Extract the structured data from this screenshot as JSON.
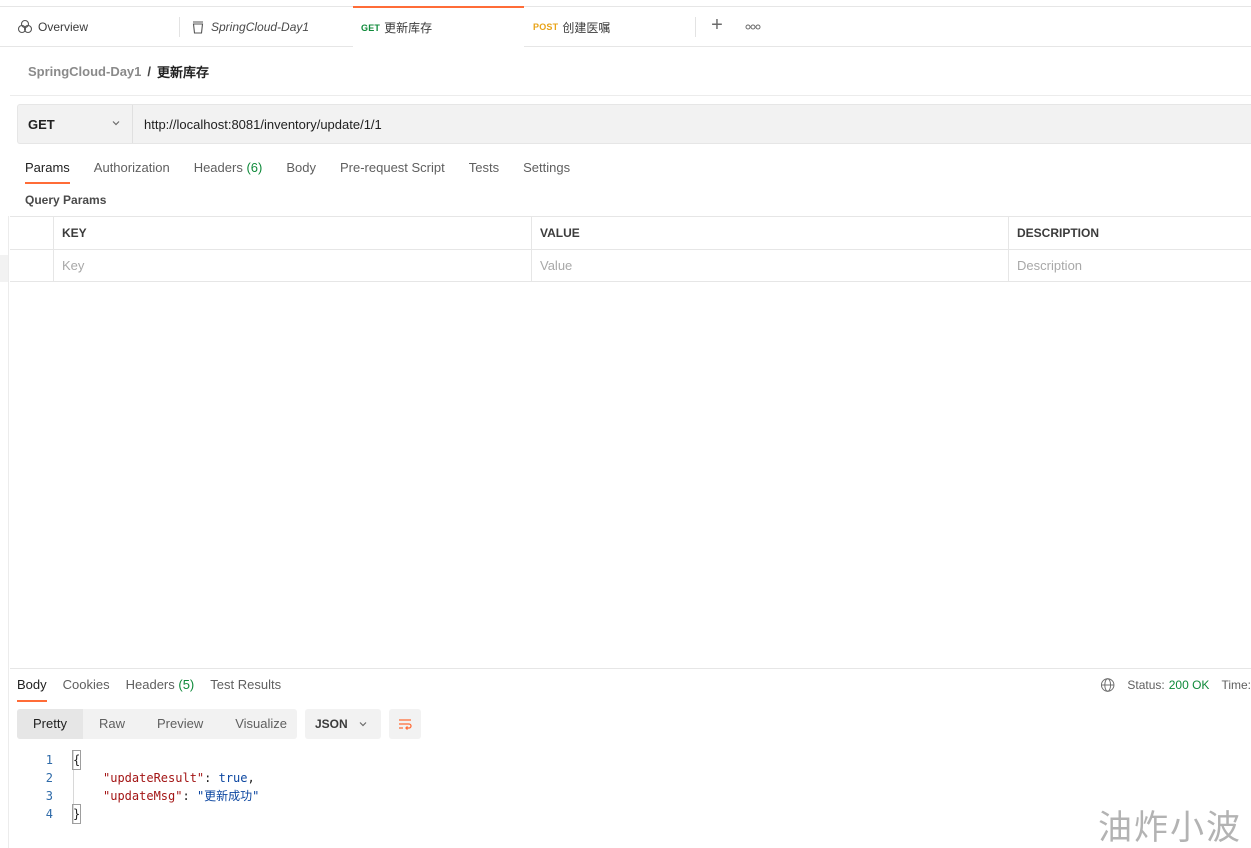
{
  "tabs": [
    {
      "label": "Overview",
      "icon": "overview-icon"
    },
    {
      "label": "SpringCloud-Day1",
      "icon": "collection-icon"
    },
    {
      "method": "GET",
      "label": "更新库存",
      "active": true
    },
    {
      "method": "POST",
      "label": "创建医嘱"
    }
  ],
  "breadcrumb": {
    "parent": "SpringCloud-Day1",
    "separator": "/",
    "current": "更新库存"
  },
  "request": {
    "method": "GET",
    "url": "http://localhost:8081/inventory/update/1/1",
    "tabs": [
      "Params",
      "Authorization",
      "Headers",
      "Body",
      "Pre-request Script",
      "Tests",
      "Settings"
    ],
    "headers_count": "(6)",
    "active_tab": "Params"
  },
  "params": {
    "title": "Query Params",
    "columns": [
      "KEY",
      "VALUE",
      "DESCRIPTION"
    ],
    "placeholders": [
      "Key",
      "Value",
      "Description"
    ]
  },
  "response": {
    "tabs": [
      "Body",
      "Cookies",
      "Headers",
      "Test Results"
    ],
    "headers_count": "(5)",
    "status_label": "Status:",
    "status_value": "200 OK",
    "time_label": "Time:",
    "views": [
      "Pretty",
      "Raw",
      "Preview",
      "Visualize"
    ],
    "format": "JSON",
    "code_lines": [
      {
        "num": "1",
        "text": "{"
      },
      {
        "num": "2",
        "key": "\"updateResult\"",
        "sep": ": ",
        "value": "true",
        "tail": ","
      },
      {
        "num": "3",
        "key": "\"updateMsg\"",
        "sep": ": ",
        "value": "\"更新成功\""
      },
      {
        "num": "4",
        "text": "}"
      }
    ]
  },
  "watermark": "油炸小波",
  "colors": {
    "accent": "#ff6c37",
    "get": "#0f8a3a",
    "post": "#e8a318"
  }
}
